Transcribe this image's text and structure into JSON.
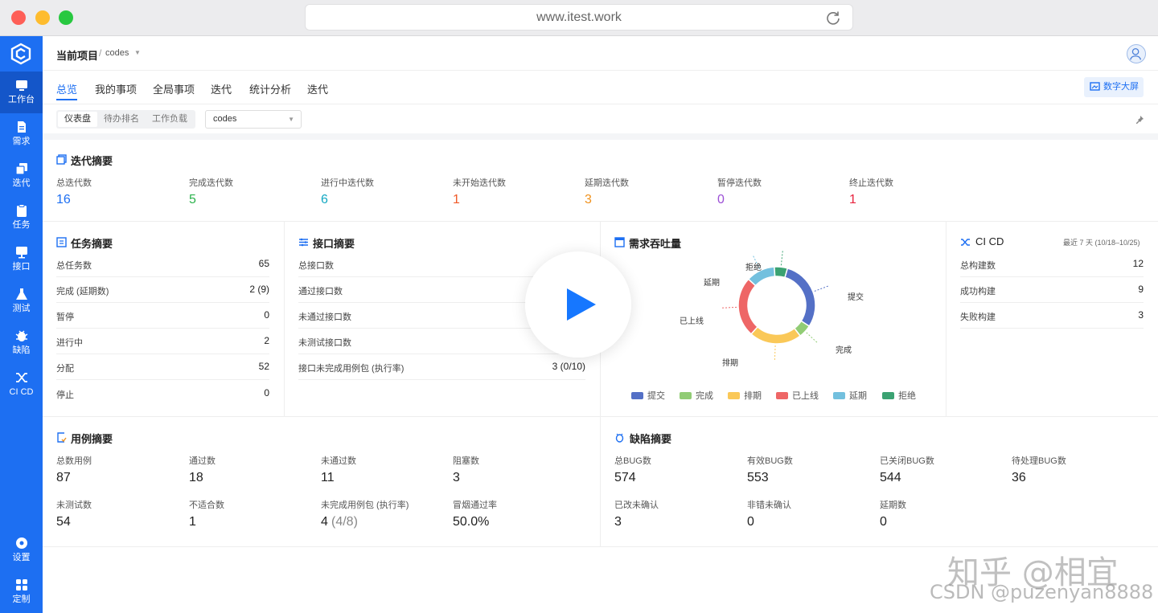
{
  "browser": {
    "url": "www.itest.work"
  },
  "sidebar": {
    "items": [
      {
        "label": "工作台",
        "icon": "workbench-icon",
        "active": true
      },
      {
        "label": "需求",
        "icon": "document-icon"
      },
      {
        "label": "迭代",
        "icon": "layers-icon"
      },
      {
        "label": "任务",
        "icon": "clipboard-icon"
      },
      {
        "label": "接口",
        "icon": "monitor-icon"
      },
      {
        "label": "测试",
        "icon": "flask-icon"
      },
      {
        "label": "缺陷",
        "icon": "bug-icon"
      },
      {
        "label": "CI CD",
        "icon": "shuffle-icon"
      },
      {
        "label": "设置",
        "icon": "settings-icon"
      },
      {
        "label": "定制",
        "icon": "grid-icon"
      }
    ]
  },
  "header": {
    "project_label": "当前项目",
    "separator": "/",
    "project_name": "codes"
  },
  "tabs": [
    "总览",
    "我的事项",
    "全局事项",
    "迭代",
    "统计分析",
    "迭代"
  ],
  "bigscreen_label": "数字大屏",
  "filter": {
    "segments": [
      "仪表盘",
      "待办排名",
      "工作负载"
    ],
    "select_value": "codes"
  },
  "iteration_summary": {
    "title": "迭代摘要",
    "stats": [
      {
        "label": "总迭代数",
        "value": "16",
        "color": "#1d6ff2"
      },
      {
        "label": "完成迭代数",
        "value": "5",
        "color": "#2bb24c"
      },
      {
        "label": "进行中迭代数",
        "value": "6",
        "color": "#13a8c2"
      },
      {
        "label": "未开始迭代数",
        "value": "1",
        "color": "#f05a28"
      },
      {
        "label": "延期迭代数",
        "value": "3",
        "color": "#f0921e"
      },
      {
        "label": "暂停迭代数",
        "value": "0",
        "color": "#9c4fd6"
      },
      {
        "label": "终止迭代数",
        "value": "1",
        "color": "#e8243f"
      }
    ]
  },
  "task_summary": {
    "title": "任务摘要",
    "rows": [
      {
        "label": "总任务数",
        "value": "65"
      },
      {
        "label": "完成 (延期数)",
        "value": "2 (9)"
      },
      {
        "label": "暂停",
        "value": "0"
      },
      {
        "label": "进行中",
        "value": "2"
      },
      {
        "label": "分配",
        "value": "52"
      },
      {
        "label": "停止",
        "value": "0"
      }
    ]
  },
  "api_summary": {
    "title": "接口摘要",
    "rows": [
      {
        "label": "总接口数",
        "value": ""
      },
      {
        "label": "通过接口数",
        "value": ""
      },
      {
        "label": "未通过接口数",
        "value": ""
      },
      {
        "label": "未测试接口数",
        "value": ""
      },
      {
        "label": "接口未完成用例包 (执行率)",
        "value": "3 (0/10)"
      }
    ]
  },
  "throughput": {
    "title": "需求吞吐量",
    "labels": [
      "拒绝",
      "延期",
      "提交",
      "已上线",
      "完成",
      "排期"
    ]
  },
  "chart_data": {
    "type": "pie",
    "title": "需求吞吐量",
    "categories": [
      "提交",
      "完成",
      "排期",
      "已上线",
      "延期",
      "拒绝"
    ],
    "values": [
      27,
      5,
      20,
      23,
      11,
      5
    ],
    "colors": [
      "#5470c6",
      "#91cc75",
      "#fac858",
      "#ee6666",
      "#73c0de",
      "#3ba272"
    ],
    "legend": "bottom"
  },
  "cicd": {
    "title": "CI CD",
    "range_label": "最近 7 天 (10/18–10/25)",
    "rows": [
      {
        "label": "总构建数",
        "value": "12"
      },
      {
        "label": "成功构建",
        "value": "9"
      },
      {
        "label": "失败构建",
        "value": "3"
      }
    ]
  },
  "case_summary": {
    "title": "用例摘要",
    "stats": [
      {
        "label": "总数用例",
        "value": "87"
      },
      {
        "label": "通过数",
        "value": "18"
      },
      {
        "label": "未通过数",
        "value": "11"
      },
      {
        "label": "阻塞数",
        "value": "3"
      },
      {
        "label": "未测试数",
        "value": "54"
      },
      {
        "label": "不适合数",
        "value": "1"
      },
      {
        "label": "未完成用例包 (执行率)",
        "value": "4",
        "extra": "(4/8)"
      },
      {
        "label": "冒烟通过率",
        "value": "50.0%"
      }
    ]
  },
  "bug_summary": {
    "title": "缺陷摘要",
    "stats": [
      {
        "label": "总BUG数",
        "value": "574"
      },
      {
        "label": "有效BUG数",
        "value": "553"
      },
      {
        "label": "已关闭BUG数",
        "value": "544"
      },
      {
        "label": "待处理BUG数",
        "value": "36"
      },
      {
        "label": "已改未确认",
        "value": "3"
      },
      {
        "label": "非错未确认",
        "value": "0"
      },
      {
        "label": "延期数",
        "value": "0"
      }
    ]
  },
  "watermark": {
    "line1": "知乎 @相宜",
    "line2": "CSDN @puzenyan8888"
  }
}
